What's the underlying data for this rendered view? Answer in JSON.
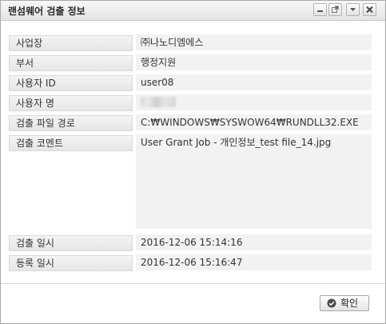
{
  "window": {
    "title": "랜섬웨어 검출 정보",
    "buttons": [
      "minimize-icon",
      "popout-icon",
      "dropdown-icon",
      "close-icon"
    ]
  },
  "fields": [
    {
      "label": "사업장",
      "value": "㈜나노디엠에스"
    },
    {
      "label": "부서",
      "value": "행정지원"
    },
    {
      "label": "사용자 ID",
      "value": "user08"
    },
    {
      "label": "사용자 명",
      "value": ""
    },
    {
      "label": "검출 파일 경로",
      "value": "C:₩WINDOWS₩SYSWOW64₩RUNDLL32.EXE"
    },
    {
      "label": "검출 코멘트",
      "value": "User Grant Job - 개인정보_test file_14.jpg"
    },
    {
      "label": "검출 일시",
      "value": "2016-12-06 15:14:16"
    },
    {
      "label": "등록 일시",
      "value": "2016-12-06 15:16:47"
    }
  ],
  "footer": {
    "ok_label": "확인"
  }
}
